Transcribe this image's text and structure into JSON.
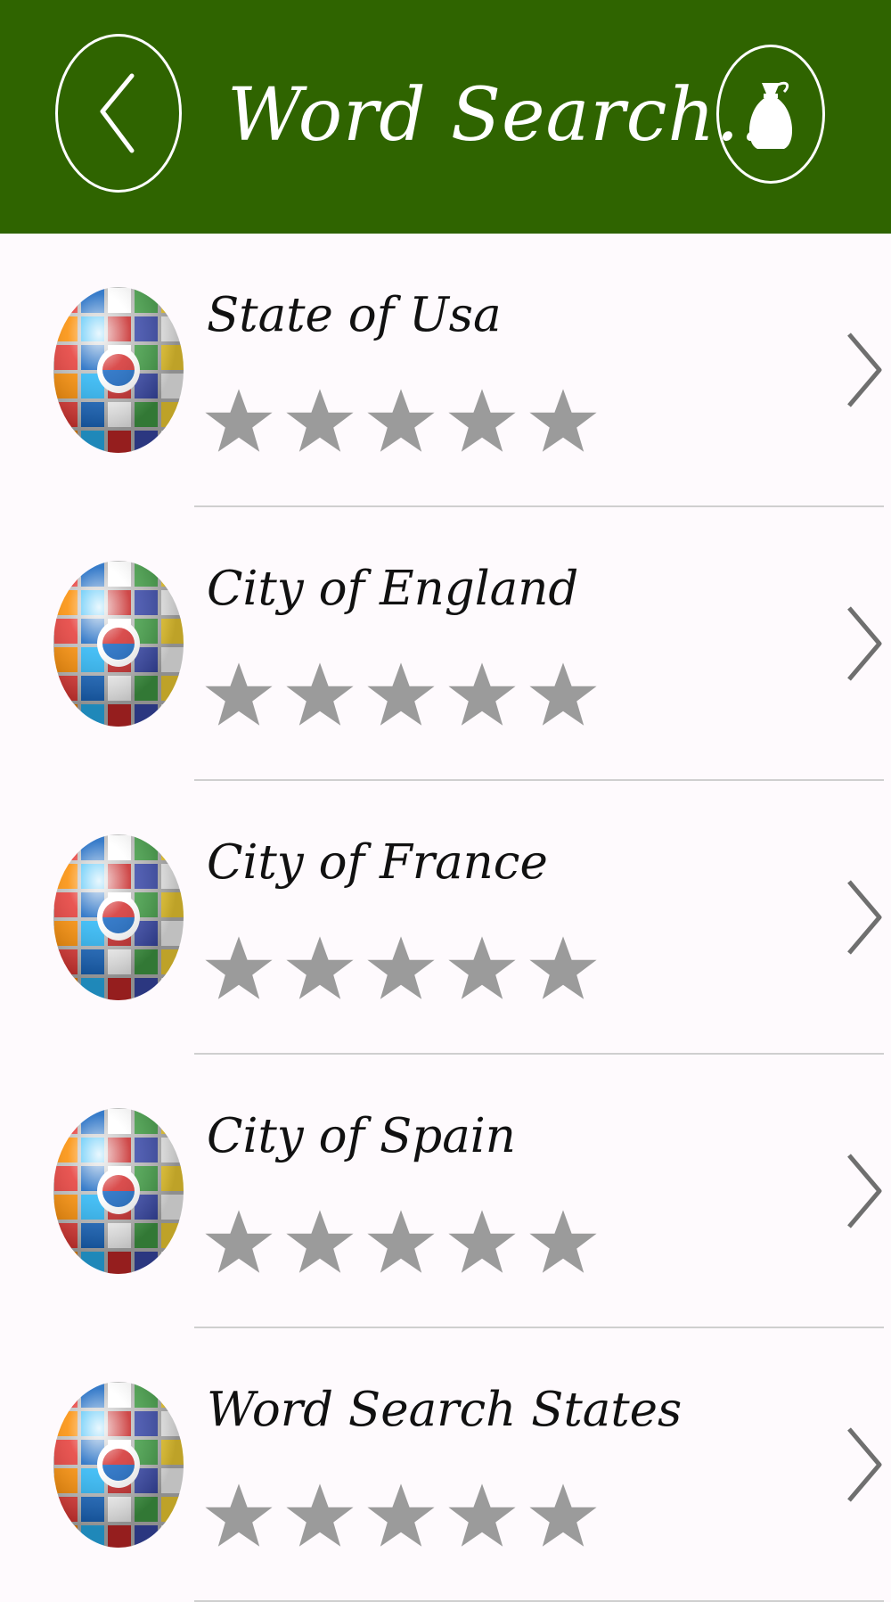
{
  "header": {
    "title": "Word Search...",
    "back_icon": "chevron-left-icon",
    "bag_icon": "money-bag-icon",
    "background_color": "#2f6400"
  },
  "categories": [
    {
      "label": "State of Usa",
      "stars_earned": 0,
      "stars_total": 5
    },
    {
      "label": "City of England",
      "stars_earned": 0,
      "stars_total": 5
    },
    {
      "label": "City of France",
      "stars_earned": 0,
      "stars_total": 5
    },
    {
      "label": "City of Spain",
      "stars_earned": 0,
      "stars_total": 5
    },
    {
      "label": "Word Search States",
      "stars_earned": 0,
      "stars_total": 5
    }
  ],
  "colors": {
    "star_inactive": "#9b9b9b",
    "chevron": "#6f6f6f",
    "divider": "#cfcfcf"
  }
}
